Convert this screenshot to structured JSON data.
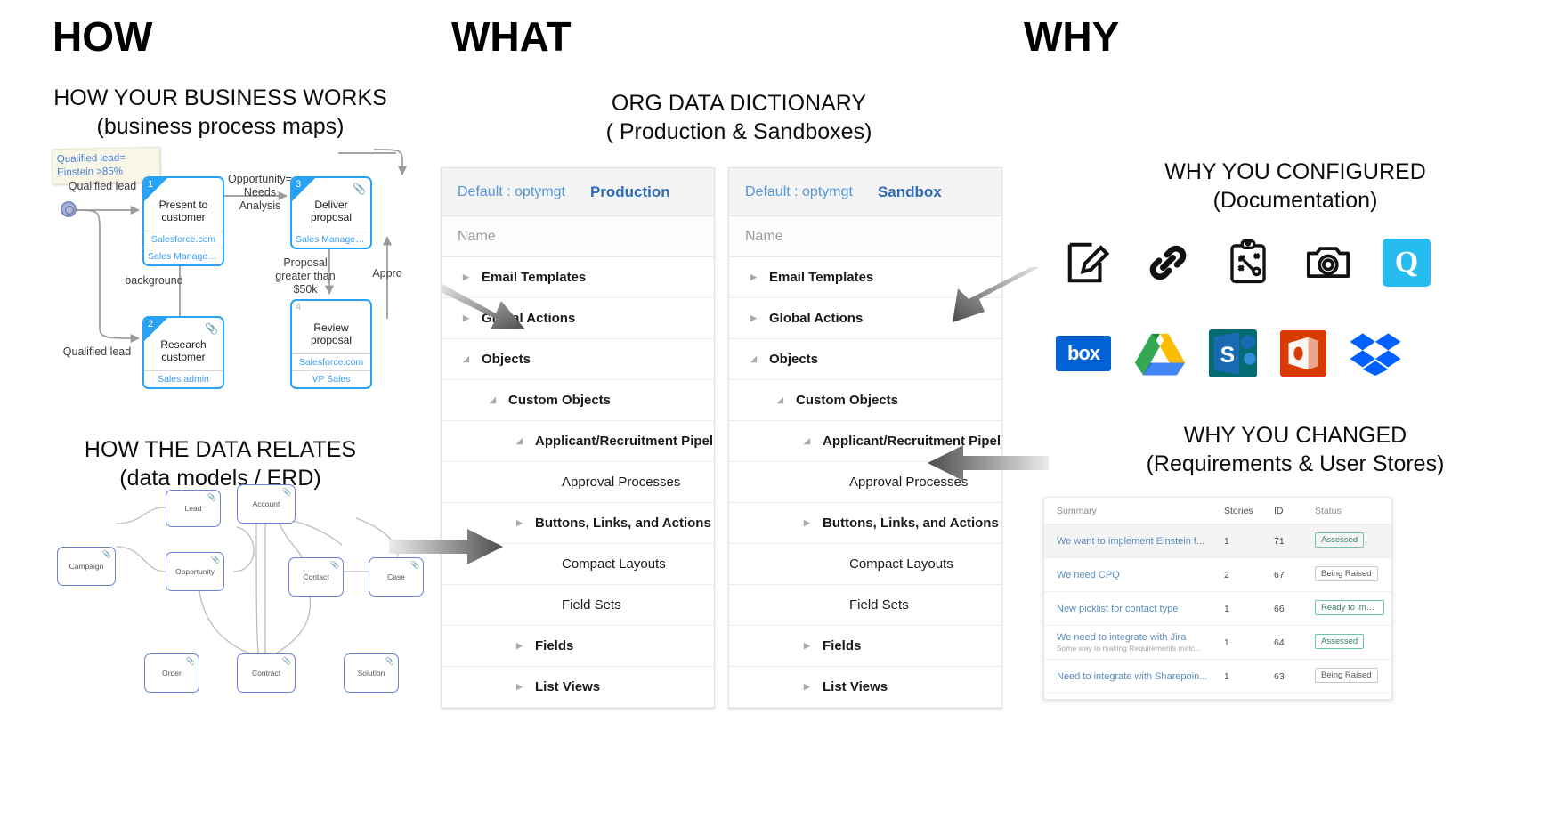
{
  "columns": {
    "how": "HOW",
    "what": "WHAT",
    "why": "WHY"
  },
  "sections": {
    "business_process": {
      "title": "HOW YOUR BUSINESS WORKS",
      "subtitle": "(business process maps)"
    },
    "data_relates": {
      "title": "HOW THE DATA RELATES",
      "subtitle": "(data models / ERD)"
    },
    "dictionary": {
      "title": "ORG DATA DICTIONARY",
      "subtitle": "( Production & Sandboxes)"
    },
    "configured": {
      "title": "WHY YOU CONFIGURED",
      "subtitle": "(Documentation)"
    },
    "changed": {
      "title": "WHY YOU CHANGED",
      "subtitle": "(Requirements & User Stores)"
    }
  },
  "process_map": {
    "note": "Qualified lead=\nEinstein >85%",
    "labels": {
      "qualified_lead_top": "Qualified lead",
      "qualified_lead_bottom": "Qualified lead",
      "background": "background",
      "opportunity": "Opportunity=\nNeeds Analysis",
      "proposal_gt": "Proposal\ngreater than\n$50k",
      "approved": "Appro"
    },
    "nodes": [
      {
        "num": "1",
        "title": "Present to customer",
        "system": "Salesforce.com",
        "owner": "Sales Management",
        "clip": false
      },
      {
        "num": "2",
        "title": "Research customer",
        "system": "",
        "owner": "Sales admin",
        "clip": true
      },
      {
        "num": "3",
        "title": "Deliver proposal",
        "system": "",
        "owner": "Sales Managem…",
        "clip": true
      },
      {
        "num": "4",
        "title": "Review proposal",
        "system": "Salesforce.com",
        "owner": "VP Sales",
        "clip": false
      }
    ]
  },
  "erd": {
    "entities": [
      "Campaign",
      "Lead",
      "Account",
      "Opportunity",
      "Contact",
      "Case",
      "Order",
      "Contract",
      "Solution"
    ]
  },
  "dictionary_panels": [
    {
      "default_label": "Default : optymgt",
      "environment": "Production",
      "name_column": "Name",
      "rows": [
        {
          "label": "Email Templates",
          "indent": 0,
          "caret": "collapsed",
          "bold": true
        },
        {
          "label": "Global Actions",
          "indent": 0,
          "caret": "collapsed",
          "bold": true
        },
        {
          "label": "Objects",
          "indent": 0,
          "caret": "expanded",
          "bold": true
        },
        {
          "label": "Custom Objects",
          "indent": 1,
          "caret": "expanded",
          "bold": true
        },
        {
          "label": "Applicant/Recruitment Pipeline ",
          "indent": 2,
          "caret": "expanded",
          "bold": true
        },
        {
          "label": "Approval Processes",
          "indent": 3,
          "caret": "none",
          "bold": false
        },
        {
          "label": "Buttons, Links, and Actions",
          "indent": 2,
          "caret": "collapsed",
          "bold": true
        },
        {
          "label": "Compact Layouts",
          "indent": 3,
          "caret": "none",
          "bold": false
        },
        {
          "label": "Field Sets",
          "indent": 3,
          "caret": "none",
          "bold": false
        },
        {
          "label": "Fields",
          "indent": 2,
          "caret": "collapsed",
          "bold": true
        },
        {
          "label": "List Views",
          "indent": 2,
          "caret": "collapsed",
          "bold": true
        }
      ]
    },
    {
      "default_label": "Default : optymgt",
      "environment": "Sandbox",
      "name_column": "Name",
      "rows": [
        {
          "label": "Email Templates",
          "indent": 0,
          "caret": "collapsed",
          "bold": true
        },
        {
          "label": "Global Actions",
          "indent": 0,
          "caret": "collapsed",
          "bold": true
        },
        {
          "label": "Objects",
          "indent": 0,
          "caret": "expanded",
          "bold": true
        },
        {
          "label": "Custom Objects",
          "indent": 1,
          "caret": "expanded",
          "bold": true
        },
        {
          "label": "Applicant/Recruitment Pipeline ",
          "indent": 2,
          "caret": "expanded",
          "bold": true
        },
        {
          "label": "Approval Processes",
          "indent": 3,
          "caret": "none",
          "bold": false
        },
        {
          "label": "Buttons, Links, and Actions",
          "indent": 2,
          "caret": "collapsed",
          "bold": true
        },
        {
          "label": "Compact Layouts",
          "indent": 3,
          "caret": "none",
          "bold": false
        },
        {
          "label": "Field Sets",
          "indent": 3,
          "caret": "none",
          "bold": false
        },
        {
          "label": "Fields",
          "indent": 2,
          "caret": "collapsed",
          "bold": true
        },
        {
          "label": "List Views",
          "indent": 2,
          "caret": "collapsed",
          "bold": true
        }
      ]
    }
  ],
  "doc_icons_row1": [
    "edit-note-icon",
    "link-chain-icon",
    "clipboard-strategy-icon",
    "camera-icon",
    "quip-logo"
  ],
  "doc_icons_row2": [
    "box-logo",
    "google-drive-logo",
    "sharepoint-logo",
    "office365-logo",
    "dropbox-logo"
  ],
  "doc_logo_text": {
    "box": "box",
    "sharepoint": "S",
    "quip": "Q"
  },
  "requirements": {
    "headers": {
      "summary": "Summary",
      "stories": "Stories",
      "id": "ID",
      "status": "Status"
    },
    "rows": [
      {
        "summary": "We want to implement Einstein f...",
        "sub": "",
        "stories": "1",
        "id": "71",
        "status": "Assessed",
        "status_style": "green"
      },
      {
        "summary": "We need CPQ",
        "sub": "",
        "stories": "2",
        "id": "67",
        "status": "Being Raised",
        "status_style": "grey"
      },
      {
        "summary": "New picklist for contact type",
        "sub": "",
        "stories": "1",
        "id": "66",
        "status": "Ready to implen",
        "status_style": "green"
      },
      {
        "summary": "We need to integrate with Jira",
        "sub": "Some way to making Requirements matc...",
        "stories": "1",
        "id": "64",
        "status": "Assessed",
        "status_style": "green"
      },
      {
        "summary": "Need to integrate with Sharepoin...",
        "sub": "",
        "stories": "1",
        "id": "63",
        "status": "Being Raised",
        "status_style": "grey"
      }
    ]
  },
  "colors": {
    "node_blue": "#27a2f5",
    "link_blue": "#3a9df2",
    "env_blue": "#2f6db5",
    "erd_border": "#6a7fd6",
    "arrow_dark": "#4a4a4a"
  }
}
